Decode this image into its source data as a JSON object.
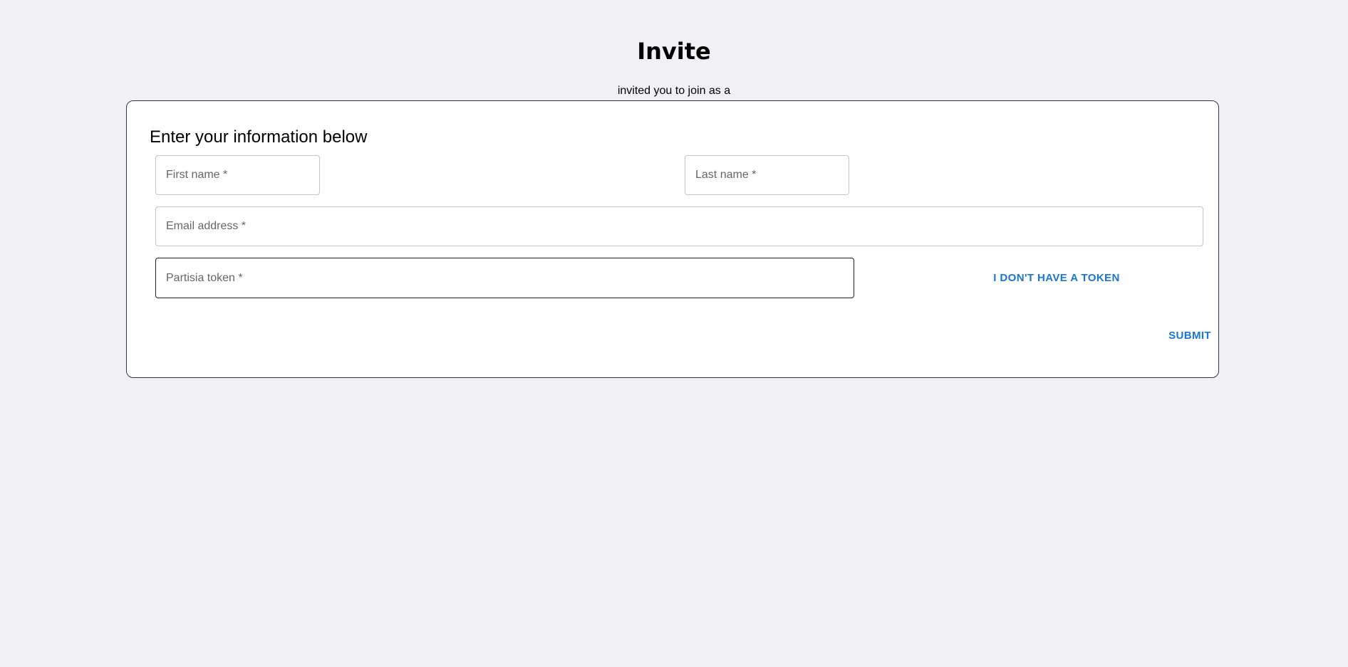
{
  "page": {
    "title": "Invite",
    "subtitle": "invited you to join as a"
  },
  "form": {
    "heading": "Enter your information below",
    "first_name": {
      "placeholder": "First name *",
      "value": ""
    },
    "last_name": {
      "placeholder": "Last name *",
      "value": ""
    },
    "email": {
      "placeholder": "Email address *",
      "value": ""
    },
    "token": {
      "placeholder": "Partisia token *",
      "value": ""
    },
    "no_token_label": "I DON'T HAVE A TOKEN",
    "submit_label": "SUBMIT"
  },
  "colors": {
    "background": "#f1f1f5",
    "card_border": "#26384c",
    "accent": "#1976d2"
  }
}
